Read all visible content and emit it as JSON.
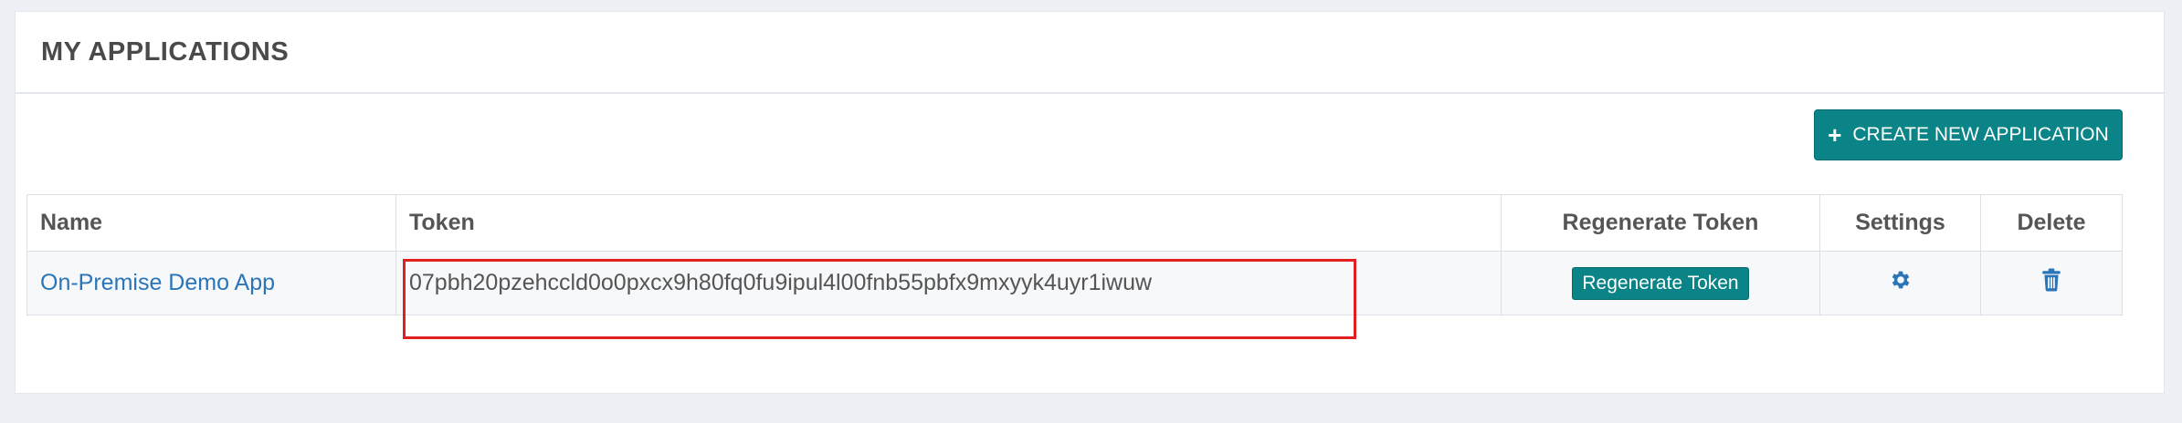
{
  "panel": {
    "title": "MY APPLICATIONS"
  },
  "create_button": {
    "icon": "plus-icon",
    "label": "CREATE NEW APPLICATION"
  },
  "table": {
    "columns": [
      "Name",
      "Token",
      "Regenerate Token",
      "Settings",
      "Delete"
    ],
    "rows": [
      {
        "name": "On-Premise Demo App",
        "token": "07pbh20pzehccld0o0pxcx9h80fq0fu9ipul4l00fnb55pbfx9mxyyk4uyr1iwuw",
        "regenerate_label": "Regenerate Token",
        "settings_icon": "gear-icon",
        "delete_icon": "trash-icon"
      }
    ]
  },
  "colors": {
    "accent": "#0a8486",
    "link": "#2a74b8",
    "highlight": "#e02020"
  }
}
